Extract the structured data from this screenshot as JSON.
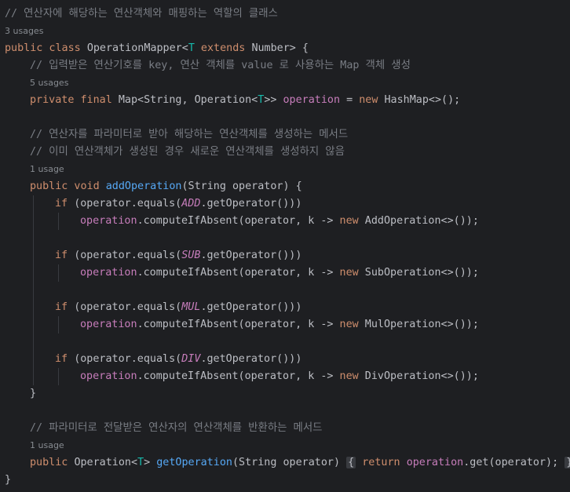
{
  "editor": {
    "lines": [
      {
        "type": "code",
        "indent": 0,
        "tokens": [
          {
            "t": "// 연산자에 해당하는 연산객체와 매핑하는 역할의 클래스",
            "c": "cmt"
          }
        ]
      },
      {
        "type": "hint",
        "indent": 0,
        "text": "3 usages"
      },
      {
        "type": "code",
        "indent": 0,
        "tokens": [
          {
            "t": "public class ",
            "c": "kw"
          },
          {
            "t": "OperationMapper<"
          },
          {
            "t": "T",
            "c": "tp"
          },
          {
            "t": " extends ",
            "c": "kw"
          },
          {
            "t": "Number> {"
          }
        ]
      },
      {
        "type": "code",
        "indent": 1,
        "tokens": [
          {
            "t": "// 입력받은 연산기호를 key, 연산 객체를 value 로 사용하는 Map 객체 생성",
            "c": "cmt"
          }
        ]
      },
      {
        "type": "hint",
        "indent": 1,
        "text": "5 usages"
      },
      {
        "type": "code",
        "indent": 1,
        "tokens": [
          {
            "t": "private final ",
            "c": "kw"
          },
          {
            "t": "Map<String, Operation<"
          },
          {
            "t": "T",
            "c": "tp"
          },
          {
            "t": ">> "
          },
          {
            "t": "operation",
            "c": "fld"
          },
          {
            "t": " = "
          },
          {
            "t": "new ",
            "c": "kw"
          },
          {
            "t": "HashMap<>();"
          }
        ]
      },
      {
        "type": "blank"
      },
      {
        "type": "code",
        "indent": 1,
        "tokens": [
          {
            "t": "// 연산자를 파라미터로 받아 해당하는 연산객체를 생성하는 메서드",
            "c": "cmt"
          }
        ]
      },
      {
        "type": "code",
        "indent": 1,
        "tokens": [
          {
            "t": "// 이미 연산객체가 생성된 경우 새로운 연산객체를 생성하지 않음",
            "c": "cmt"
          }
        ]
      },
      {
        "type": "hint",
        "indent": 1,
        "text": "1 usage"
      },
      {
        "type": "code",
        "indent": 1,
        "tokens": [
          {
            "t": "public void ",
            "c": "kw"
          },
          {
            "t": "addOperation",
            "c": "fn"
          },
          {
            "t": "(String operator) {"
          }
        ]
      },
      {
        "type": "code",
        "indent": 2,
        "tokens": [
          {
            "t": "if ",
            "c": "kw"
          },
          {
            "t": "(operator.equals("
          },
          {
            "t": "ADD",
            "c": "cst"
          },
          {
            "t": ".getOperator()))"
          }
        ]
      },
      {
        "type": "code",
        "indent": 3,
        "tokens": [
          {
            "t": "operation",
            "c": "fld"
          },
          {
            "t": ".computeIfAbsent(operator, k -> "
          },
          {
            "t": "new ",
            "c": "kw"
          },
          {
            "t": "AddOperation<>());"
          }
        ]
      },
      {
        "type": "blank"
      },
      {
        "type": "code",
        "indent": 2,
        "tokens": [
          {
            "t": "if ",
            "c": "kw"
          },
          {
            "t": "(operator.equals("
          },
          {
            "t": "SUB",
            "c": "cst"
          },
          {
            "t": ".getOperator()))"
          }
        ]
      },
      {
        "type": "code",
        "indent": 3,
        "tokens": [
          {
            "t": "operation",
            "c": "fld"
          },
          {
            "t": ".computeIfAbsent(operator, k -> "
          },
          {
            "t": "new ",
            "c": "kw"
          },
          {
            "t": "SubOperation<>());"
          }
        ]
      },
      {
        "type": "blank"
      },
      {
        "type": "code",
        "indent": 2,
        "tokens": [
          {
            "t": "if ",
            "c": "kw"
          },
          {
            "t": "(operator.equals("
          },
          {
            "t": "MUL",
            "c": "cst"
          },
          {
            "t": ".getOperator()))"
          }
        ]
      },
      {
        "type": "code",
        "indent": 3,
        "tokens": [
          {
            "t": "operation",
            "c": "fld"
          },
          {
            "t": ".computeIfAbsent(operator, k -> "
          },
          {
            "t": "new ",
            "c": "kw"
          },
          {
            "t": "MulOperation<>());"
          }
        ]
      },
      {
        "type": "blank"
      },
      {
        "type": "code",
        "indent": 2,
        "tokens": [
          {
            "t": "if ",
            "c": "kw"
          },
          {
            "t": "(operator.equals("
          },
          {
            "t": "DIV",
            "c": "cst"
          },
          {
            "t": ".getOperator()))"
          }
        ]
      },
      {
        "type": "code",
        "indent": 3,
        "tokens": [
          {
            "t": "operation",
            "c": "fld"
          },
          {
            "t": ".computeIfAbsent(operator, k -> "
          },
          {
            "t": "new ",
            "c": "kw"
          },
          {
            "t": "DivOperation<>());"
          }
        ]
      },
      {
        "type": "code",
        "indent": 1,
        "tokens": [
          {
            "t": "}"
          }
        ]
      },
      {
        "type": "blank"
      },
      {
        "type": "code",
        "indent": 1,
        "tokens": [
          {
            "t": "// 파라미터로 전달받은 연산자의 연산객체를 반환하는 메서드",
            "c": "cmt"
          }
        ]
      },
      {
        "type": "hint",
        "indent": 1,
        "text": "1 usage"
      },
      {
        "type": "code",
        "indent": 1,
        "tokens": [
          {
            "t": "public ",
            "c": "kw"
          },
          {
            "t": "Operation<"
          },
          {
            "t": "T",
            "c": "tp"
          },
          {
            "t": "> "
          },
          {
            "t": "getOperation",
            "c": "fn"
          },
          {
            "t": "(String operator) "
          },
          {
            "t": "{",
            "c": "fold"
          },
          {
            "t": " "
          },
          {
            "t": "return ",
            "c": "kw"
          },
          {
            "t": "operation",
            "c": "fld"
          },
          {
            "t": ".get(operator); "
          },
          {
            "t": "}",
            "c": "fold"
          }
        ]
      },
      {
        "type": "code",
        "indent": 0,
        "tokens": [
          {
            "t": "}"
          }
        ]
      }
    ]
  }
}
